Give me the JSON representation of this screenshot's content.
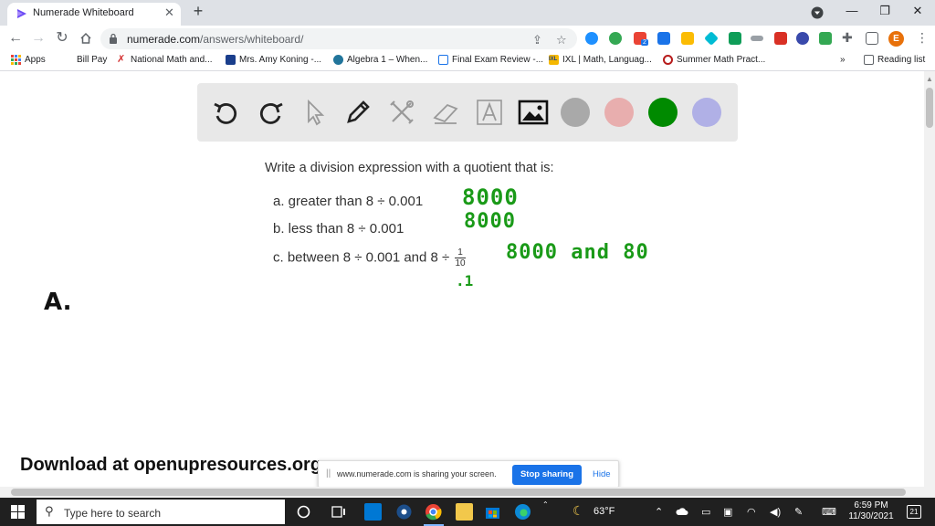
{
  "browser": {
    "tab_title": "Numerade Whiteboard",
    "new_tab": "+",
    "window_controls": {
      "minimize": "—",
      "restore": "❐",
      "close": "✕"
    },
    "url_domain": "numerade.com",
    "url_path": "/answers/whiteboard/",
    "profile_initial": "E",
    "extension_badge": "2"
  },
  "bookmarks": {
    "items": [
      {
        "label": "Apps",
        "icon": "apps-grid-icon"
      },
      {
        "label": "Bill Pay",
        "icon": ""
      },
      {
        "label": "National Math and...",
        "icon": "x-logo-icon"
      },
      {
        "label": "Mrs. Amy Koning -...",
        "icon": "blue-square-icon"
      },
      {
        "label": "Algebra 1 – When...",
        "icon": "wordpress-icon"
      },
      {
        "label": "Final Exam Review -...",
        "icon": "doc-icon"
      },
      {
        "label": "IXL | Math, Languag...",
        "icon": "ixl-icon"
      },
      {
        "label": "Summer Math Pract...",
        "icon": "target-icon"
      }
    ],
    "more": "»",
    "reading_list": "Reading list"
  },
  "whiteboard": {
    "colors": [
      "#a9a9a9",
      "#e8aeae",
      "#008a00",
      "#b0b0e6"
    ],
    "problem": {
      "heading": "Write a division expression with a quotient that is:",
      "a": "a. greater than 8 ÷ 0.001",
      "b": "b. less than 8 ÷ 0.001",
      "c_prefix": "c. between 8 ÷ 0.001 and 8 ÷",
      "c_num": "1",
      "c_den": "10"
    },
    "handwriting": {
      "ans_a": "8000",
      "ans_b": "8000",
      "ans_c": "8000  and  80",
      "tenth": ".1",
      "label_a": "A."
    },
    "download_text": "Download at openupresources.org"
  },
  "share_bar": {
    "message": "www.numerade.com is sharing your screen.",
    "stop": "Stop sharing",
    "hide": "Hide",
    "grip": "||"
  },
  "taskbar": {
    "search_placeholder": "Type here to search",
    "weather": "63°F",
    "time": "6:59 PM",
    "date": "11/30/2021",
    "notifications": "21"
  }
}
